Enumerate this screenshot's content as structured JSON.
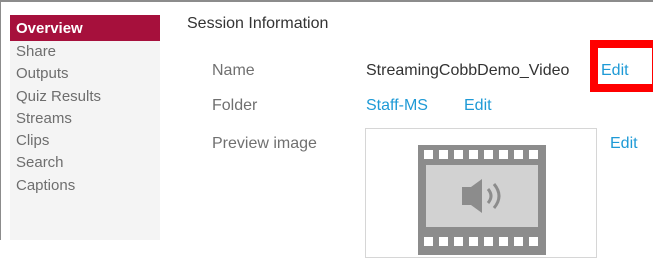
{
  "sidebar": {
    "items": [
      {
        "label": "Overview",
        "active": true
      },
      {
        "label": "Share"
      },
      {
        "label": "Outputs"
      },
      {
        "label": "Quiz Results"
      },
      {
        "label": "Streams"
      },
      {
        "label": "Clips"
      },
      {
        "label": "Search"
      },
      {
        "label": "Captions"
      }
    ]
  },
  "session": {
    "title": "Session Information",
    "name_label": "Name",
    "name_value": "StreamingCobbDemo_Video",
    "name_edit": "Edit",
    "folder_label": "Folder",
    "folder_value": "Staff-MS",
    "folder_edit": "Edit",
    "preview_label": "Preview image",
    "preview_edit": "Edit",
    "preview_icon": "video-file-audio-icon"
  },
  "colors": {
    "accent": "#a6103c",
    "link": "#1e9ad6",
    "highlight": "#ff0000"
  }
}
